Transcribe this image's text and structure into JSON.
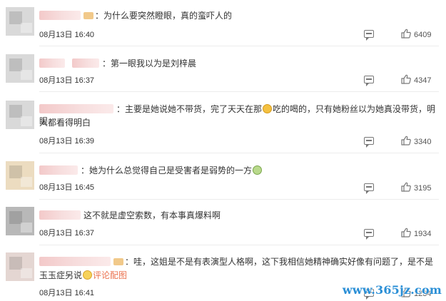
{
  "comments": [
    {
      "text": "：为什么要突然瞪眼，真的蛮吓人的",
      "time": "08月13日 16:40",
      "likes": "6409",
      "has_badge": true
    },
    {
      "text": "：第一眼我以为是刘梓晨",
      "time": "08月13日 16:37",
      "likes": "4347"
    },
    {
      "text_a": "：主要是她说她不带货，完了天天在那",
      "text_b": "吃的喝的，只有她粉丝以为她真没带货，明眼",
      "text_c": "人都看得明白",
      "emoji": "sad-face-emoji",
      "time": "08月13日 16:39",
      "likes": "3340"
    },
    {
      "text": "：她为什么总觉得自己是受害者是弱势的一方",
      "emoji": "tea-emoji",
      "time": "08月13日 16:45",
      "likes": "3195"
    },
    {
      "text": "这不就是虚空索数，有本事真爆料啊",
      "time": "08月13日 16:37",
      "likes": "1934"
    },
    {
      "text_a": "：哇，这姐是不是有表演型人格啊，这下我相信她精神确实好像有问题了，是不是",
      "text_b": "玉玉症另说",
      "link": "评论配图",
      "emoji": "smile-emoji",
      "time": "08月13日 16:41",
      "likes": "1234"
    }
  ],
  "watermark": "www.365jz.com",
  "colors": {
    "link": "#eb7350",
    "watermark": "#2b8fd6",
    "name_blur": "#f3c9c9"
  }
}
